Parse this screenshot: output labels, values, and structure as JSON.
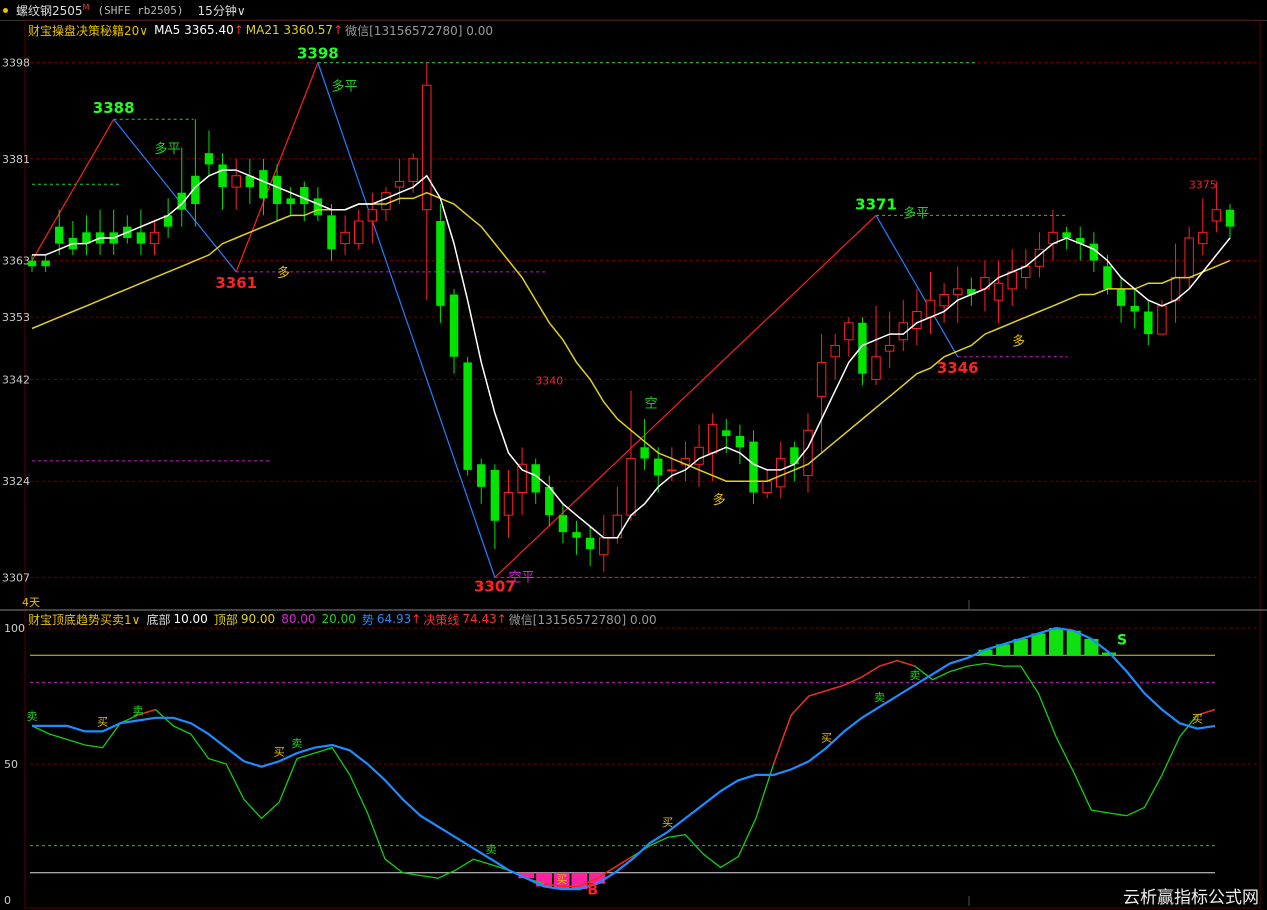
{
  "header": {
    "symbol": "螺纹钢2505",
    "badge": "M",
    "code": "(SHFE rb2505)",
    "period": "15分钟",
    "period_caret": "∨"
  },
  "main_legend": {
    "indicator": "财宝操盘决策秘籍20",
    "caret": "∨",
    "ma5": "MA5 3365.40",
    "ma21": "MA21 3360.57",
    "up_arrow": "↑",
    "wechat": "微信[13156572780] 0.00"
  },
  "osc_legend": {
    "indicator": "财宝顶底趋势买卖1",
    "caret": "∨",
    "bottom": "底部",
    "bottom_val": "10.00",
    "top": "顶部",
    "top_val": "90.00",
    "v80": "80.00",
    "v20": "20.00",
    "shi": "势",
    "shi_val": "64.93",
    "up_arrow": "↑",
    "jcx": "决策线",
    "jcx_val": "74.43",
    "up_arrow2": "↑",
    "wechat": "微信[13156572780] 0.00"
  },
  "footer_left": "4天",
  "watermark": "云析赢指标公式网",
  "colors": {
    "up": "#ff2020",
    "down": "#00e400",
    "ma5": "#ffffff",
    "ma21": "#e0d020",
    "red_line": "#ff2020",
    "blue_line": "#2080ff",
    "grid": "#6a0000",
    "osc_blue": "#1e8cff",
    "osc_green": "#10d010",
    "osc_red": "#ff2020"
  },
  "chart_data": [
    {
      "type": "candlestick",
      "ylim": [
        3303,
        3402
      ],
      "y_ticks": [
        3398,
        3381,
        3363,
        3353,
        3342,
        3324,
        3307
      ],
      "candles": [
        [
          3363,
          3362,
          3364,
          3361
        ],
        [
          3363,
          3362,
          3364,
          3361
        ],
        [
          3369,
          3366,
          3372,
          3364
        ],
        [
          3367,
          3365,
          3370,
          3364
        ],
        [
          3368,
          3366,
          3371,
          3364
        ],
        [
          3368,
          3366,
          3372,
          3364
        ],
        [
          3368,
          3366,
          3372,
          3364
        ],
        [
          3369,
          3367,
          3371,
          3366
        ],
        [
          3368,
          3366,
          3372,
          3364
        ],
        [
          3366,
          3368,
          3370,
          3364
        ],
        [
          3371,
          3369,
          3374,
          3367
        ],
        [
          3375,
          3372,
          3383,
          3369
        ],
        [
          3378,
          3373,
          3388,
          3369
        ],
        [
          3382,
          3380,
          3386,
          3378
        ],
        [
          3380,
          3376,
          3382,
          3372
        ],
        [
          3376,
          3378,
          3381,
          3372
        ],
        [
          3378,
          3376,
          3381,
          3373
        ],
        [
          3379,
          3374,
          3381,
          3371
        ],
        [
          3378,
          3373,
          3380,
          3370
        ],
        [
          3374,
          3373,
          3376,
          3371
        ],
        [
          3376,
          3373,
          3377,
          3370
        ],
        [
          3374,
          3371,
          3376,
          3370
        ],
        [
          3371,
          3365,
          3373,
          3363
        ],
        [
          3366,
          3368,
          3371,
          3364
        ],
        [
          3366,
          3370,
          3372,
          3365
        ],
        [
          3370,
          3372,
          3375,
          3366
        ],
        [
          3372,
          3375,
          3376,
          3370
        ],
        [
          3376,
          3377,
          3381,
          3373
        ],
        [
          3377,
          3381,
          3382,
          3375
        ],
        [
          3372,
          3394,
          3398,
          3356
        ],
        [
          3370,
          3355,
          3373,
          3352
        ],
        [
          3357,
          3346,
          3358,
          3343
        ],
        [
          3345,
          3326,
          3346,
          3325
        ],
        [
          3327,
          3323,
          3328,
          3320
        ],
        [
          3326,
          3317,
          3327,
          3312
        ],
        [
          3318,
          3322,
          3326,
          3314
        ],
        [
          3322,
          3327,
          3330,
          3318
        ],
        [
          3327,
          3322,
          3328,
          3320
        ],
        [
          3323,
          3318,
          3325,
          3316
        ],
        [
          3318,
          3315,
          3320,
          3313
        ],
        [
          3315,
          3314,
          3317,
          3311
        ],
        [
          3314,
          3312,
          3316,
          3309
        ],
        [
          3311,
          3314,
          3318,
          3308
        ],
        [
          3314,
          3318,
          3323,
          3313
        ],
        [
          3318,
          3328,
          3340,
          3317
        ],
        [
          3330,
          3328,
          3335,
          3326
        ],
        [
          3328,
          3325,
          3330,
          3322
        ],
        [
          3326,
          3326,
          3330,
          3324
        ],
        [
          3327,
          3328,
          3331,
          3324
        ],
        [
          3327,
          3330,
          3334,
          3323
        ],
        [
          3329,
          3334,
          3336,
          3324
        ],
        [
          3333,
          3332,
          3335,
          3329
        ],
        [
          3332,
          3330,
          3334,
          3327
        ],
        [
          3331,
          3322,
          3333,
          3320
        ],
        [
          3322,
          3324,
          3326,
          3321
        ],
        [
          3323,
          3328,
          3331,
          3321
        ],
        [
          3330,
          3327,
          3331,
          3324
        ],
        [
          3325,
          3333,
          3336,
          3322
        ],
        [
          3339,
          3345,
          3350,
          3329
        ],
        [
          3346,
          3348,
          3350,
          3342
        ],
        [
          3349,
          3352,
          3353,
          3346
        ],
        [
          3352,
          3343,
          3353,
          3341
        ],
        [
          3342,
          3346,
          3355,
          3341
        ],
        [
          3347,
          3348,
          3354,
          3344
        ],
        [
          3349,
          3352,
          3356,
          3347
        ],
        [
          3351,
          3354,
          3358,
          3348
        ],
        [
          3353,
          3356,
          3361,
          3350
        ],
        [
          3355,
          3357,
          3359,
          3352
        ],
        [
          3357,
          3358,
          3362,
          3352
        ],
        [
          3358,
          3357,
          3360,
          3355
        ],
        [
          3358,
          3360,
          3363,
          3354
        ],
        [
          3356,
          3359,
          3363,
          3352
        ],
        [
          3358,
          3361,
          3365,
          3355
        ],
        [
          3360,
          3362,
          3365,
          3358
        ],
        [
          3362,
          3365,
          3368,
          3360
        ],
        [
          3366,
          3368,
          3372,
          3363
        ],
        [
          3368,
          3367,
          3369,
          3365
        ],
        [
          3367,
          3366,
          3369,
          3363
        ],
        [
          3366,
          3363,
          3368,
          3361
        ],
        [
          3362,
          3358,
          3364,
          3357
        ],
        [
          3358,
          3355,
          3360,
          3352
        ],
        [
          3355,
          3354,
          3358,
          3351
        ],
        [
          3354,
          3350,
          3356,
          3348
        ],
        [
          3350,
          3355,
          3356,
          3350
        ],
        [
          3356,
          3360,
          3366,
          3352
        ],
        [
          3360,
          3367,
          3369,
          3358
        ],
        [
          3366,
          3368,
          3374,
          3364
        ],
        [
          3370,
          3372,
          3377,
          3368
        ],
        [
          3372,
          3369,
          3373,
          3367
        ]
      ],
      "ma5": [
        3364,
        3364,
        3365,
        3366,
        3366,
        3367,
        3367,
        3368,
        3369,
        3370,
        3371,
        3373,
        3376,
        3378,
        3379,
        3379,
        3378,
        3377,
        3376,
        3375,
        3374,
        3373,
        3372,
        3372,
        3373,
        3373,
        3374,
        3375,
        3376,
        3378,
        3374,
        3366,
        3356,
        3345,
        3336,
        3329,
        3326,
        3325,
        3323,
        3320,
        3318,
        3316,
        3314,
        3314,
        3318,
        3320,
        3323,
        3325,
        3326,
        3328,
        3329,
        3330,
        3329,
        3327,
        3326,
        3326,
        3327,
        3330,
        3335,
        3340,
        3345,
        3348,
        3349,
        3350,
        3350,
        3352,
        3353,
        3354,
        3356,
        3357,
        3358,
        3360,
        3361,
        3362,
        3364,
        3366,
        3367,
        3366,
        3365,
        3363,
        3360,
        3358,
        3356,
        3355,
        3356,
        3358,
        3361,
        3364,
        3367
      ],
      "ma21": [
        3351,
        3352,
        3353,
        3354,
        3355,
        3356,
        3357,
        3358,
        3359,
        3360,
        3361,
        3362,
        3363,
        3364,
        3366,
        3367,
        3368,
        3369,
        3370,
        3371,
        3371,
        3372,
        3372,
        3372,
        3373,
        3373,
        3373,
        3374,
        3374,
        3375,
        3374,
        3373,
        3371,
        3369,
        3366,
        3363,
        3360,
        3356,
        3352,
        3349,
        3345,
        3342,
        3338,
        3335,
        3333,
        3331,
        3329,
        3328,
        3327,
        3326,
        3325,
        3324,
        3324,
        3324,
        3324,
        3325,
        3326,
        3327,
        3329,
        3331,
        3333,
        3335,
        3337,
        3339,
        3341,
        3343,
        3344,
        3346,
        3347,
        3348,
        3350,
        3351,
        3352,
        3353,
        3354,
        3355,
        3356,
        3357,
        3357,
        3358,
        3358,
        3358,
        3359,
        3359,
        3360,
        3360,
        3361,
        3362,
        3363
      ],
      "zigzag": [
        [
          0,
          3363
        ],
        [
          6,
          3388
        ],
        [
          15,
          3361
        ],
        [
          21,
          3398
        ],
        [
          34,
          3307
        ],
        [
          62,
          3371
        ],
        [
          68,
          3346
        ]
      ],
      "price_labels": [
        "3388",
        "3361",
        "3398",
        "3307",
        "3340",
        "3371",
        "3346",
        "3375"
      ],
      "signal_labels": [
        "多平",
        "多",
        "多平",
        "空",
        "多",
        "多平",
        "多",
        "空平"
      ]
    },
    {
      "type": "line",
      "ylim": [
        0,
        100
      ],
      "y_ticks": [
        "100",
        "50",
        "0"
      ],
      "hlines": [
        90,
        80,
        20,
        10
      ],
      "blue": [
        64,
        64,
        64,
        62,
        62,
        65,
        66,
        67,
        67,
        65,
        61,
        56,
        51,
        49,
        51,
        54,
        56,
        57,
        55,
        50,
        44,
        37,
        31,
        27,
        23,
        19,
        15,
        11,
        8,
        5,
        4,
        4,
        6,
        10,
        15,
        21,
        25,
        30,
        35,
        40,
        44,
        46,
        46,
        48,
        51,
        56,
        62,
        67,
        71,
        75,
        79,
        83,
        87,
        89,
        92,
        94,
        96,
        98,
        100,
        99,
        96,
        91,
        84,
        76,
        70,
        65,
        63,
        64
      ],
      "green": [
        64,
        61,
        59,
        57,
        56,
        65,
        68,
        70,
        64,
        61,
        52,
        50,
        37,
        30,
        36,
        52,
        54,
        56,
        46,
        32,
        15,
        10,
        9,
        8,
        11,
        15,
        13,
        11,
        8,
        6,
        5,
        5,
        8,
        12,
        16,
        20,
        23,
        24,
        17,
        12,
        16,
        30,
        50,
        68,
        75,
        77,
        79,
        82,
        86,
        88,
        86,
        81,
        84,
        86,
        87,
        86,
        86,
        76,
        60,
        47,
        33,
        32,
        31,
        34,
        46,
        60,
        68,
        70
      ],
      "buy_markers": [
        "买",
        "买",
        "买",
        "买",
        "买",
        "买"
      ],
      "sell_markers": [
        "卖",
        "卖",
        "卖",
        "卖",
        "卖",
        "卖"
      ],
      "signal_labels": [
        "B",
        "S"
      ]
    }
  ]
}
